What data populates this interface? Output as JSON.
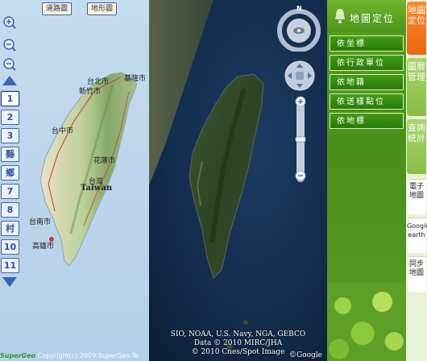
{
  "left_map": {
    "tabs": {
      "road": "道路圖",
      "terrain": "地形圖"
    },
    "zoom_levels": [
      "1",
      "2",
      "3",
      "縣",
      "鄉",
      "7",
      "8",
      "村",
      "10",
      "11"
    ],
    "active_zoom": "1",
    "labels": {
      "keelung": "基隆市",
      "taipei": "台北市",
      "hsinchu": "新竹市",
      "taichung": "台中市",
      "hualien": "花蓮市",
      "taiwan_cn": "台灣",
      "taiwan_en": "Taiwan",
      "tainan": "台南市",
      "kaohsiung": "高雄市"
    },
    "copyright_brand": "SuperGeo",
    "copyright_text": "Copyright(c) 2009 SuperGeo Te"
  },
  "satellite": {
    "attribution_line1": "SIO, NOAA, U.S. Navy, NGA, GEBCO",
    "attribution_line2": "Data © 2010 MIRC/JHA",
    "attribution_line3": "© 2010 Cnes/Spot Image",
    "google_logo": "©Google",
    "compass_n": "N"
  },
  "right_panel": {
    "title": "地圖定位",
    "buttons": [
      "依坐標",
      "依行政單位",
      "依地籍",
      "依送樣點位",
      "依地標"
    ]
  },
  "side_tabs": {
    "map_locate": "地圖定位",
    "layer_manage": "圖層管理",
    "query_stats": "查詢統計",
    "e_map": "電子地圖",
    "google_earth": "Google earth",
    "sync_map": "同步地圖"
  },
  "colors": {
    "accent_green": "#4b9419",
    "accent_orange": "#f07a1c",
    "button_green": "#2a7a0a",
    "zoom_blue": "#2a52a6"
  }
}
